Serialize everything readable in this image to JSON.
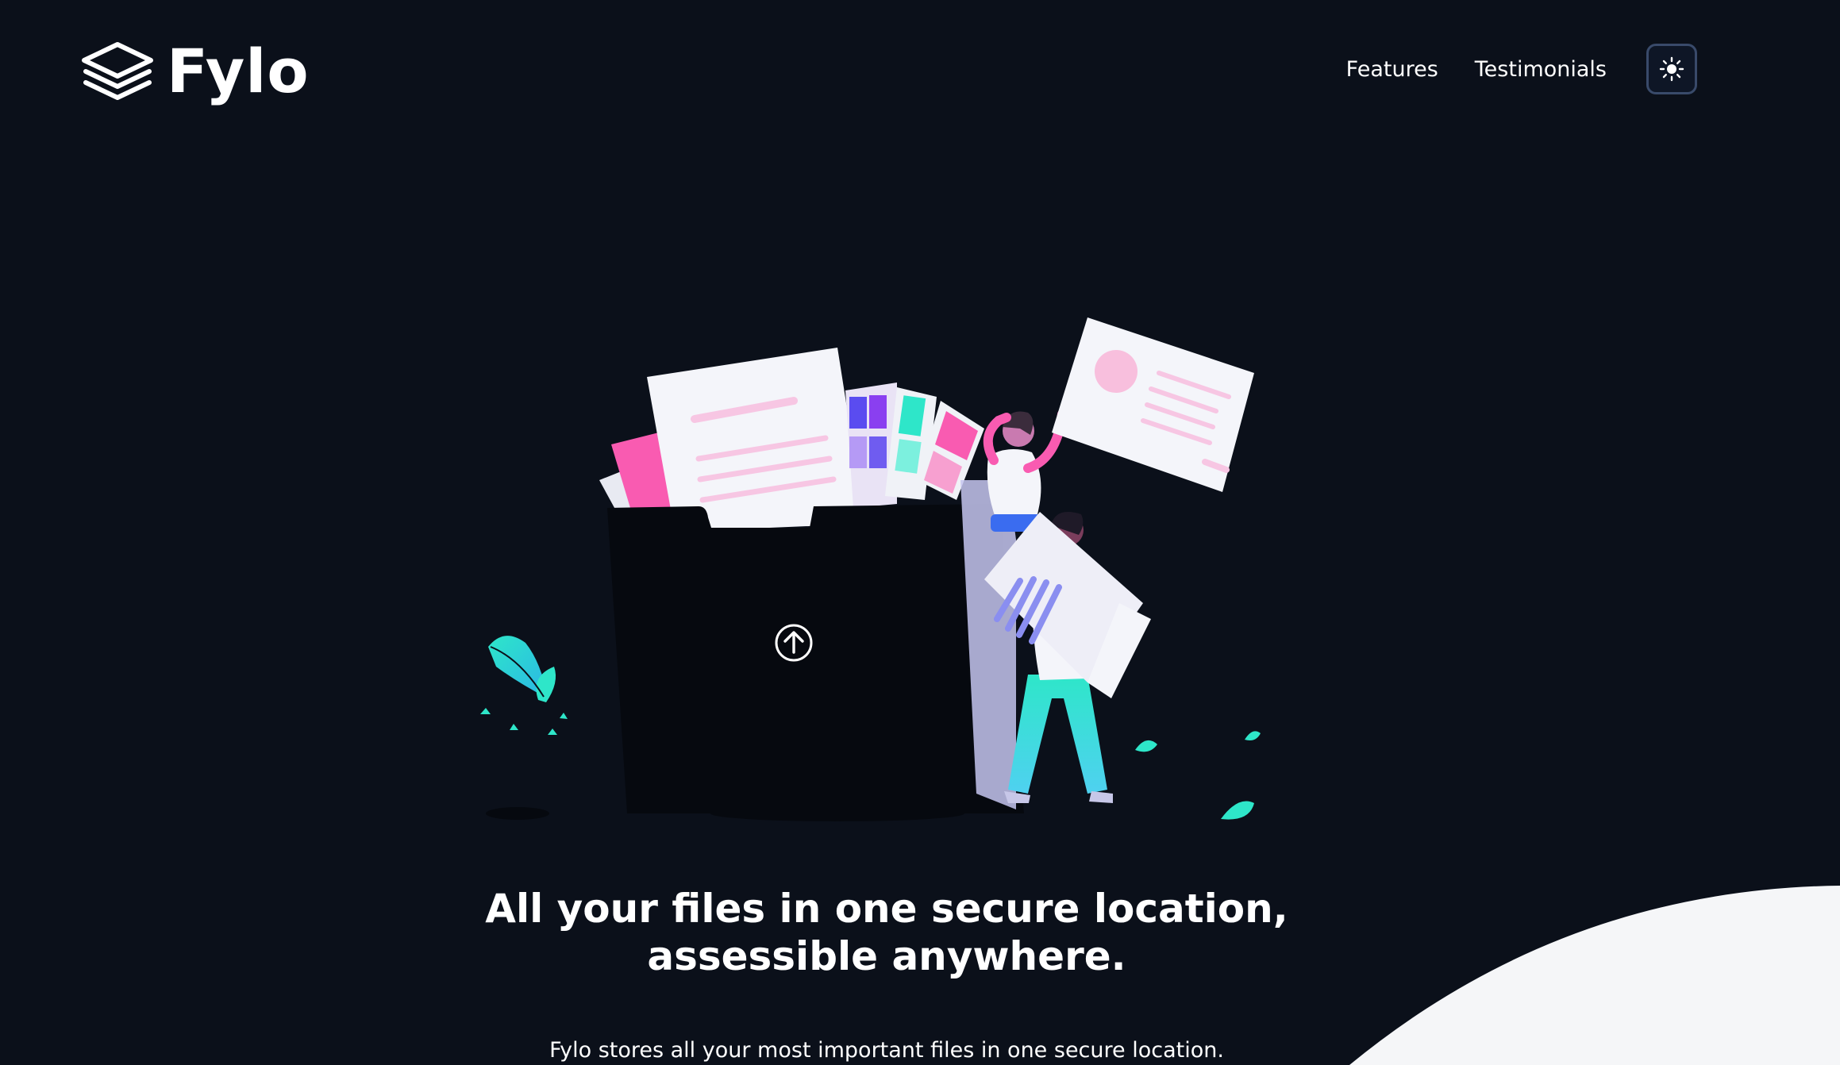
{
  "header": {
    "logo_text": "Fylo",
    "nav": [
      {
        "label": "Features"
      },
      {
        "label": "Testimonials"
      }
    ],
    "theme_toggle_icon": "sun-icon"
  },
  "hero": {
    "title_line1": "All your files in one secure location,",
    "title_line2": "assessible anywhere.",
    "subtitle": "Fylo stores all your most important files in one secure location.",
    "upload_icon": "arrow-up-circle-icon"
  },
  "colors": {
    "background": "#0b101a",
    "text": "#ffffff",
    "accent_pink": "#f95bb1",
    "accent_teal": "#2ee6c9",
    "curve": "#f5f6f8"
  }
}
